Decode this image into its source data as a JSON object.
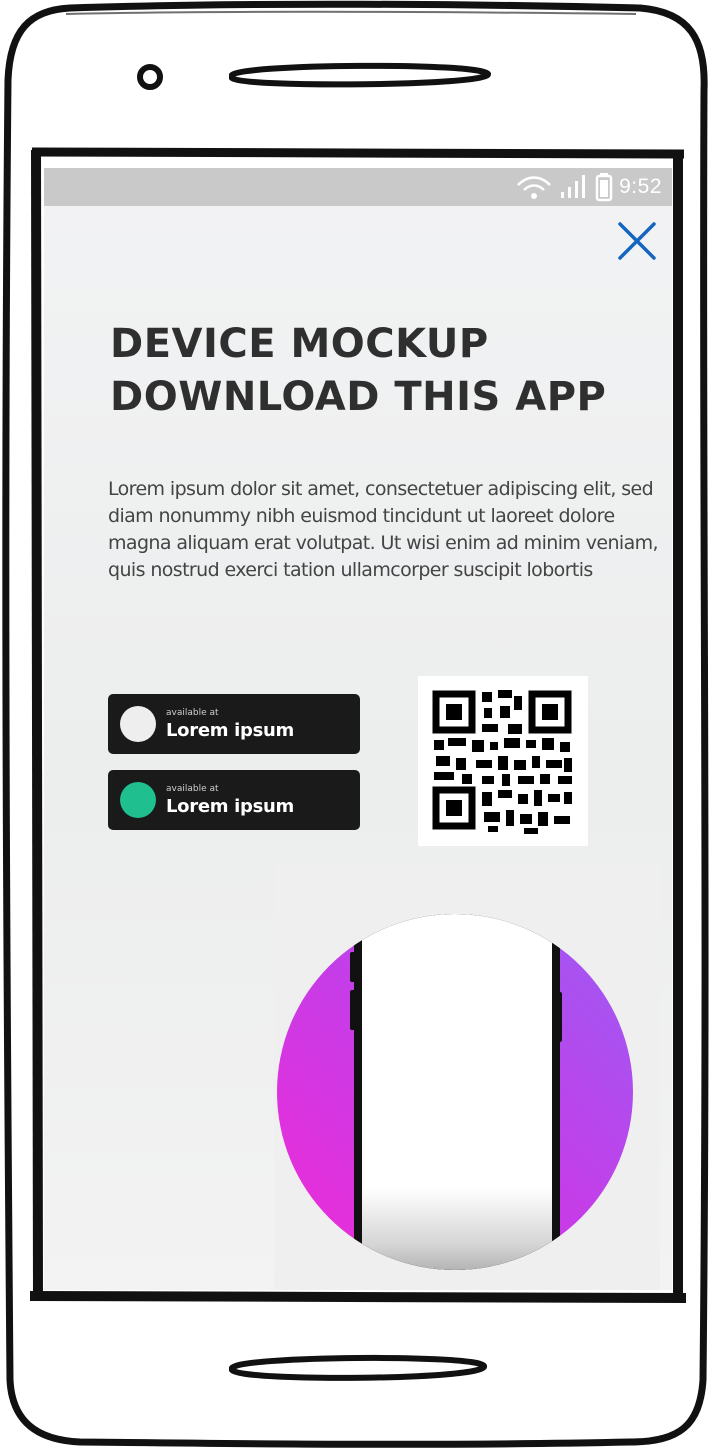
{
  "status_bar": {
    "time": "9:52",
    "icons": [
      "wifi-icon",
      "signal-icon",
      "battery-icon"
    ]
  },
  "ad": {
    "title_line1": "DEVICE MOCKUP",
    "title_line2": "DOWNLOAD THIS APP",
    "body": "Lorem ipsum dolor sit amet, consectetuer adipiscing elit, sed diam nonummy nibh euismod tincidunt ut laoreet dolore magna aliquam erat volutpat. Ut wisi enim ad minim veniam, quis nostrud exerci tation ullamcorper suscipit lobortis",
    "close_icon": "close-icon",
    "badges": [
      {
        "small": "available at",
        "label": "Lorem ipsum",
        "dot_color": "#eeeeee"
      },
      {
        "small": "available at",
        "label": "Lorem ipsum",
        "dot_color": "#1fbf8f"
      }
    ],
    "qr_icon": "qr-code-icon",
    "colors": {
      "close": "#1565c0",
      "gradient_top": "#a35cf0",
      "gradient_bottom": "#e82ad8",
      "badge_bg": "#1a1a1a"
    }
  }
}
